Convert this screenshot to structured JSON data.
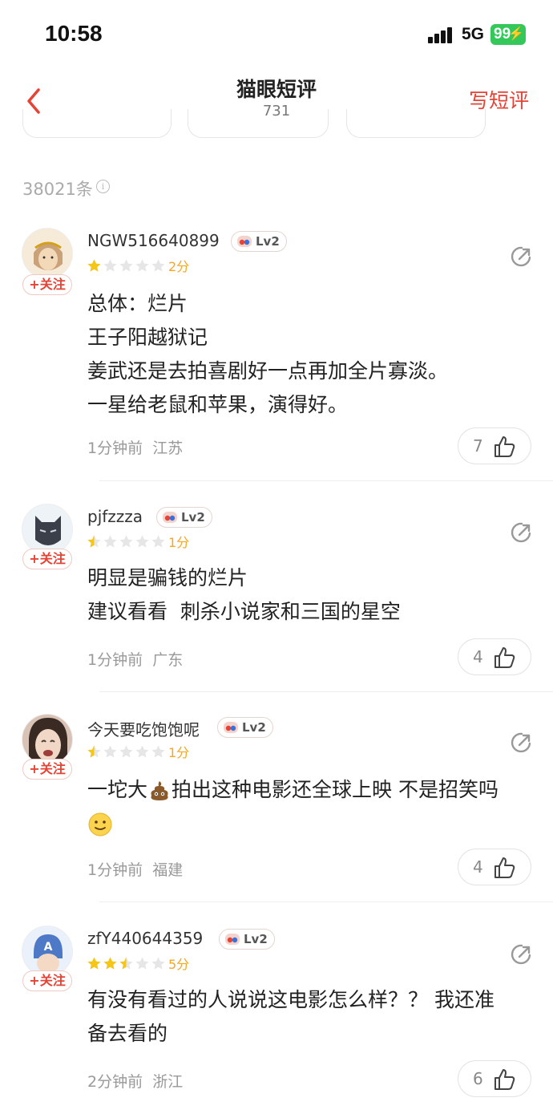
{
  "status_bar": {
    "time": "10:58",
    "network": "5G",
    "battery": "99"
  },
  "nav": {
    "title": "猫眼短评",
    "subtitle": "731",
    "write_label": "写短评"
  },
  "review_count": "38021条",
  "follow_label": "+关注",
  "comments": [
    {
      "username": "NGW516640899",
      "level": "Lv2",
      "rating": 1,
      "score": "2分",
      "lines": [
        "总体：烂片",
        "王子阳越狱记",
        "姜武还是去拍喜剧好一点再加全片寡淡。",
        "一星给老鼠和苹果，演得好。"
      ],
      "time": "1分钟前",
      "region": "江苏",
      "likes": "7",
      "avatar": "monkey-king-avatar"
    },
    {
      "username": "pjfzzza",
      "level": "Lv2",
      "rating": 0.5,
      "score": "1分",
      "lines": [
        "明显是骗钱的烂片",
        "建议看看  刺杀小说家和三国的星空"
      ],
      "time": "1分钟前",
      "region": "广东",
      "likes": "4",
      "avatar": "panther-mask-avatar"
    },
    {
      "username": "今天要吃饱饱呢",
      "level": "Lv2",
      "rating": 0.5,
      "score": "1分",
      "line1_a": "一坨大",
      "line1_b": "拍出这种电影还全球上映 不是招笑吗",
      "time": "1分钟前",
      "region": "福建",
      "likes": "4",
      "avatar": "crying-face-avatar"
    },
    {
      "username": "zfY440644359",
      "level": "Lv2",
      "rating": 2.5,
      "score": "5分",
      "lines": [
        "有没有看过的人说说这电影怎么样？？ 我还准",
        "备去看的"
      ],
      "time": "2分钟前",
      "region": "浙江",
      "likes": "6",
      "avatar": "captain-helmet-avatar"
    }
  ],
  "colors": {
    "accent": "#e64335",
    "star": "#f5c518",
    "battery": "#34c759"
  }
}
